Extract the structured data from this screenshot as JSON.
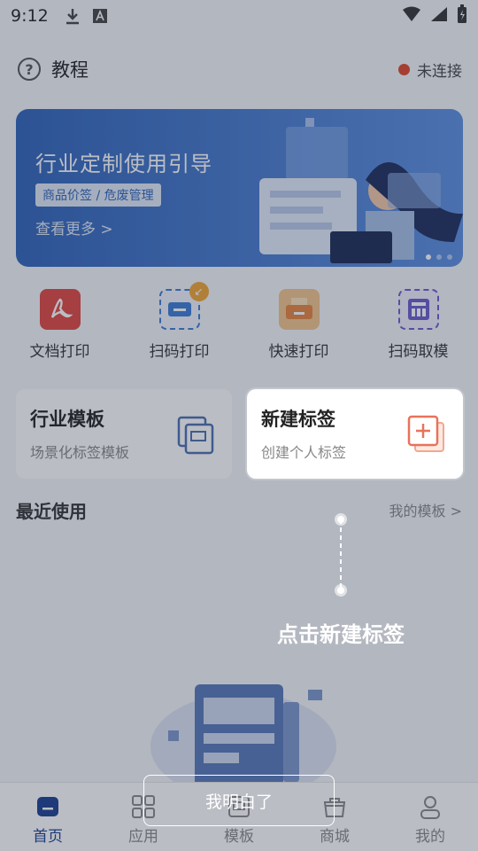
{
  "status_bar": {
    "time": "9:12"
  },
  "header": {
    "title": "教程",
    "connection_status": "未连接"
  },
  "banner": {
    "title": "行业定制使用引导",
    "tag": "商品价签 / 危废管理",
    "more_link": "查看更多 >"
  },
  "quick_actions": [
    {
      "label": "文档打印",
      "icon": "pdf-icon",
      "color": "#e0463e"
    },
    {
      "label": "扫码打印",
      "icon": "scan-print-icon",
      "color": "#3a7bd5"
    },
    {
      "label": "快速打印",
      "icon": "printer-icon",
      "color": "#e8833a"
    },
    {
      "label": "扫码取模",
      "icon": "scan-template-icon",
      "color": "#6a5acd"
    }
  ],
  "cards": {
    "industry": {
      "title": "行业模板",
      "subtitle": "场景化标签模板"
    },
    "new_label": {
      "title": "新建标签",
      "subtitle": "创建个人标签"
    }
  },
  "recent": {
    "title": "最近使用",
    "more": "我的模板 >"
  },
  "guide": {
    "text": "点击新建标签",
    "button": "我明白了"
  },
  "tabbar": [
    {
      "label": "首页",
      "icon": "home-icon",
      "active": true
    },
    {
      "label": "应用",
      "icon": "apps-icon",
      "active": false
    },
    {
      "label": "模板",
      "icon": "template-icon",
      "active": false
    },
    {
      "label": "商城",
      "icon": "shop-icon",
      "active": false
    },
    {
      "label": "我的",
      "icon": "profile-icon",
      "active": false
    }
  ],
  "colors": {
    "accent": "#1a3f8f",
    "banner": "#3a6fc6",
    "new_label_icon": "#e8735a"
  }
}
